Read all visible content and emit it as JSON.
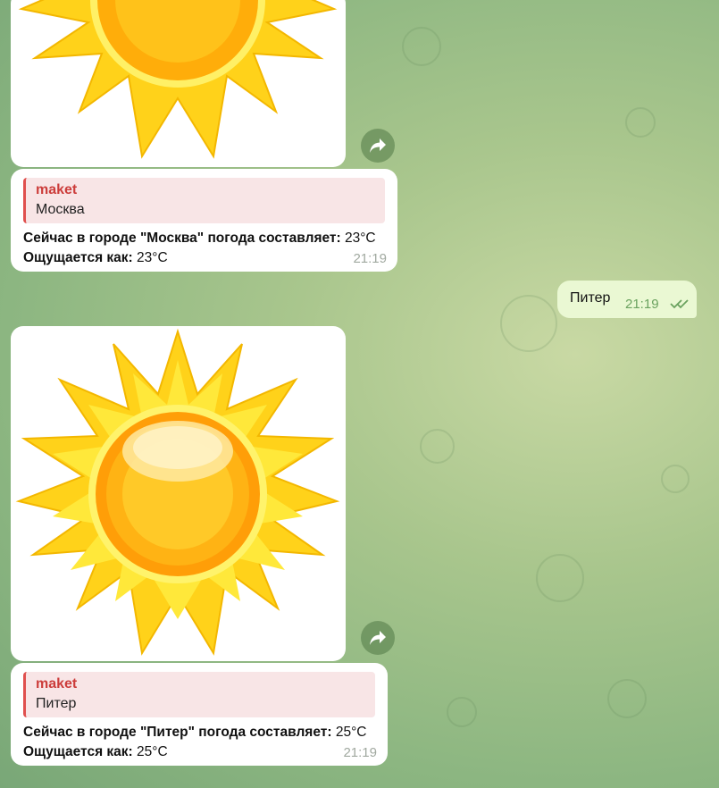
{
  "messages": [
    {
      "reply_author": "maket",
      "reply_text": "Москва",
      "line1_label": "Сейчас в городе \"Москва\" погода составляет:",
      "line1_value": "23°C",
      "line2_label": "Ощущается как:",
      "line2_value": "23°C",
      "time": "21:19"
    },
    {
      "reply_author": "maket",
      "reply_text": "Питер",
      "line1_label": "Сейчас в городе \"Питер\" погода составляет:",
      "line1_value": "25°C",
      "line2_label": "Ощущается как:",
      "line2_value": "25°C",
      "time": "21:19"
    }
  ],
  "outgoing": {
    "text": "Питер",
    "time": "21:19",
    "status_icon": "double-check-icon"
  },
  "icons": {
    "forward": "forward-arrow-icon",
    "image": "sun-image"
  },
  "colors": {
    "reply_accent": "#e0504e",
    "outgoing_bubble": "#eaf8d3",
    "incoming_bubble": "#ffffff"
  }
}
